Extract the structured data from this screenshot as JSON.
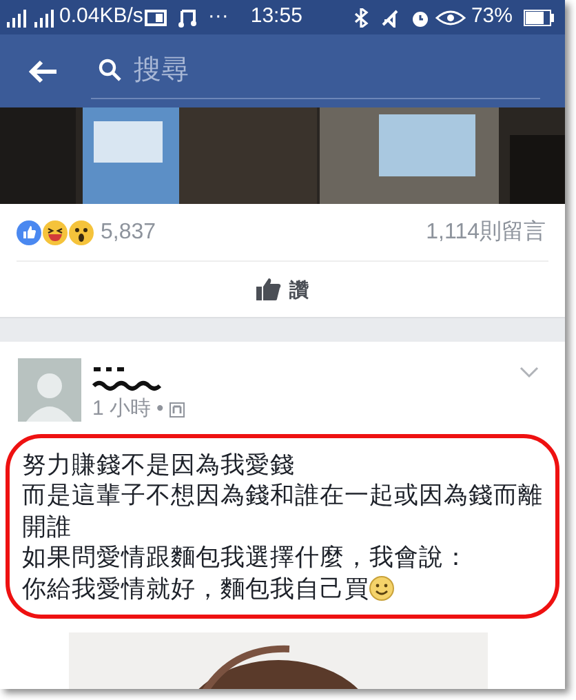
{
  "status_bar": {
    "speed": "0.04KB/s",
    "more": "···",
    "time": "13:55",
    "battery": "73%"
  },
  "search": {
    "placeholder": "搜尋"
  },
  "feed_post": {
    "reaction_count": "5,837",
    "comment_count": "1,114則留言",
    "like_button": "讚"
  },
  "post": {
    "time": "1 小時",
    "separator": "•",
    "lines": [
      "努力賺錢不是因為我愛錢",
      "而是這輩子不想因為錢和誰在一起或因為錢而離開誰",
      "如果問愛情跟麵包我選擇什麼，我會說：",
      "你給我愛情就好，麵包我自己買"
    ],
    "highlighted": true
  }
}
